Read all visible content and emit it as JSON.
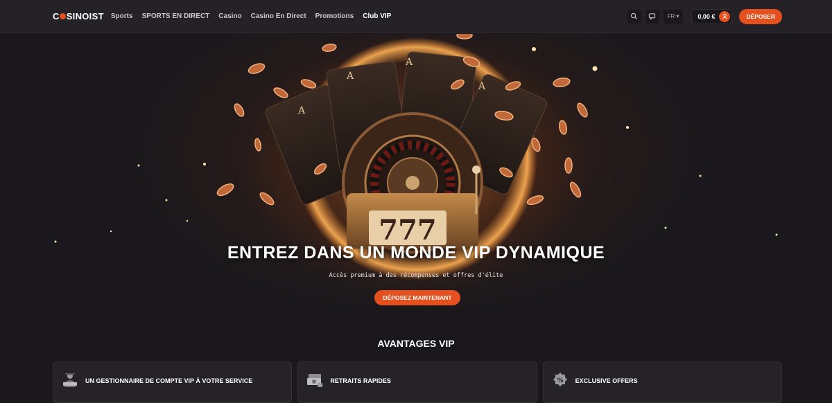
{
  "header": {
    "logo_text": "CASINOIST",
    "nav": [
      {
        "label": "Sports"
      },
      {
        "label": "SPORTS EN DIRECT"
      },
      {
        "label": "Casino"
      },
      {
        "label": "Casino En Direct"
      },
      {
        "label": "Promotions"
      },
      {
        "label": "Club VIP"
      }
    ],
    "language": "FR",
    "balance": "0,00 €",
    "deposit_label": "DÉPOSER"
  },
  "hero": {
    "title": "ENTREZ DANS UN MONDE VIP DYNAMIQUE",
    "subtitle": "Accès premium à des récompenses et offres d'élite",
    "cta_label": "DÉPOSEZ MAINTENANT",
    "slot_numbers": "777"
  },
  "advantages": {
    "title": "AVANTAGES VIP",
    "cards": [
      {
        "label": "UN GESTIONNAIRE DE COMPTE VIP À VOTRE SERVICE",
        "icon": "account-manager-icon"
      },
      {
        "label": "RETRAITS RAPIDES",
        "icon": "cash-withdrawal-icon"
      },
      {
        "label": "EXCLUSIVE OFFERS",
        "icon": "percent-badge-icon"
      }
    ]
  },
  "colors": {
    "accent": "#e5501e",
    "header_bg": "#242226",
    "page_bg": "#1a181c",
    "card_bg": "#252328"
  }
}
